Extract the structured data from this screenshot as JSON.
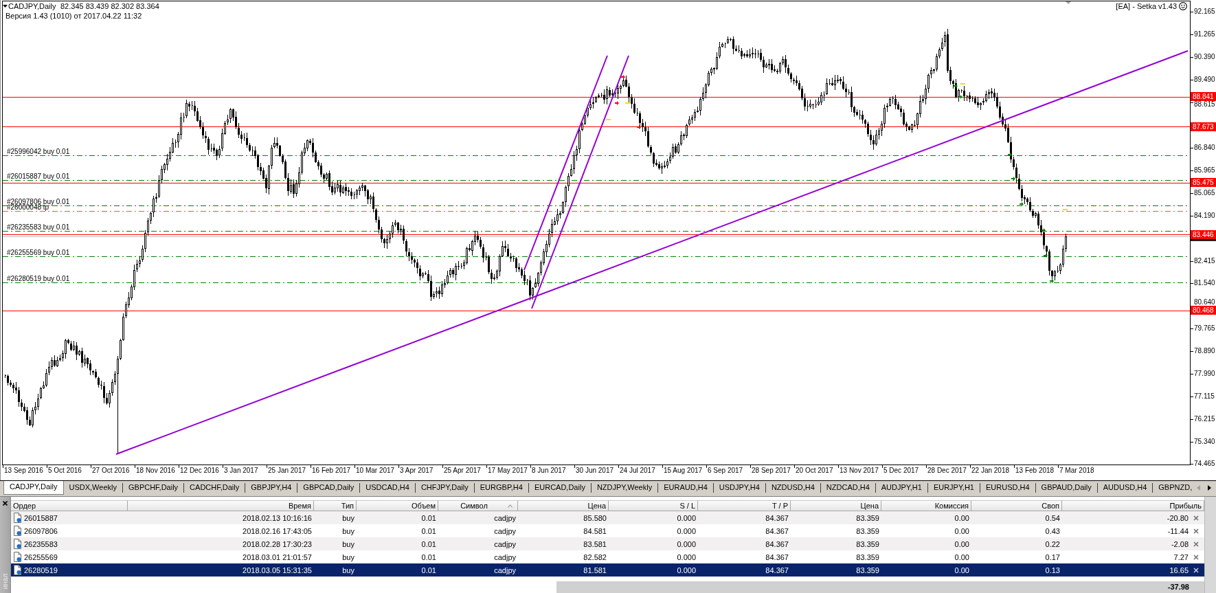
{
  "chart": {
    "symbol": "CADJPY,Daily",
    "ohlc": "82.345 83.439 82.302 83.364",
    "version": "Версия 1.43 (1010) от 2017.04.22 11:32",
    "expert": "[EA] - Setka v1.43",
    "price_ticks": [
      "92.165",
      "91.265",
      "90.390",
      "89.490",
      "88.615",
      "86.840",
      "85.965",
      "85.065",
      "84.190",
      "82.415",
      "81.540",
      "80.640",
      "79.765",
      "78.890",
      "77.990",
      "77.115",
      "76.215",
      "75.340",
      "74.465"
    ],
    "level_tags": [
      "88.841",
      "87.673",
      "85.475",
      "83.446",
      "80.468"
    ],
    "order_lines": [
      {
        "label": "#25996042 buy 0.01",
        "kind": "buy"
      },
      {
        "label": "#26015887 buy 0.01",
        "kind": "buy"
      },
      {
        "label": "#26097806 buy 0.01",
        "kind": "buy"
      },
      {
        "label": "#26000048 tp",
        "kind": "tp"
      },
      {
        "label": "#26235583 buy 0.01",
        "kind": "buy"
      },
      {
        "label": "#26255569 buy 0.01",
        "kind": "buy"
      },
      {
        "label": "#26280519 buy 0.01",
        "kind": "buy"
      }
    ],
    "date_ticks": [
      "13 Sep 2016",
      "5 Oct 2016",
      "27 Oct 2016",
      "18 Nov 2016",
      "12 Dec 2016",
      "3 Jan 2017",
      "25 Jan 2017",
      "16 Feb 2017",
      "10 Mar 2017",
      "3 Apr 2017",
      "25 Apr 2017",
      "17 May 2017",
      "8 Jun 2017",
      "30 Jun 2017",
      "24 Jul 2017",
      "15 Aug 2017",
      "6 Sep 2017",
      "28 Sep 2017",
      "20 Oct 2017",
      "13 Nov 2017",
      "5 Dec 2017",
      "28 Dec 2017",
      "22 Jan 2018",
      "13 Feb 2018",
      "7 Mar 2018"
    ]
  },
  "tabs": [
    {
      "label": "CADJPY,Daily",
      "selected": true
    },
    {
      "label": "USDX,Weekly",
      "selected": false
    },
    {
      "label": "GBPCHF,Daily",
      "selected": false
    },
    {
      "label": "CADCHF,Daily",
      "selected": false
    },
    {
      "label": "GBPJPY,H4",
      "selected": false
    },
    {
      "label": "GBPCAD,Daily",
      "selected": false
    },
    {
      "label": "USDCAD,H4",
      "selected": false
    },
    {
      "label": "CHFJPY,Daily",
      "selected": false
    },
    {
      "label": "EURGBP,H4",
      "selected": false
    },
    {
      "label": "EURCAD,Daily",
      "selected": false
    },
    {
      "label": "NZDJPY,Weekly",
      "selected": false
    },
    {
      "label": "EURAUD,H4",
      "selected": false
    },
    {
      "label": "USDJPY,H4",
      "selected": false
    },
    {
      "label": "NZDUSD,H4",
      "selected": false
    },
    {
      "label": "NZDCAD,H4",
      "selected": false
    },
    {
      "label": "AUDJPY,H1",
      "selected": false
    },
    {
      "label": "EURJPY,H1",
      "selected": false
    },
    {
      "label": "EURUSD,H4",
      "selected": false
    },
    {
      "label": "GBPAUD,Daily",
      "selected": false
    },
    {
      "label": "AUDUSD,H4",
      "selected": false
    },
    {
      "label": "GBPNZD,",
      "selected": false
    }
  ],
  "tab_scroll_buttons": [
    {
      "kind": "left",
      "disabled": true
    },
    {
      "kind": "right",
      "disabled": false
    }
  ],
  "terminal": {
    "side_label": "инал",
    "columns": [
      {
        "label": "Ордер",
        "sorted": false
      },
      {
        "label": "Время",
        "sorted": false
      },
      {
        "label": "Тип",
        "sorted": false
      },
      {
        "label": "Объем",
        "sorted": false
      },
      {
        "label": "Символ",
        "sorted": true
      },
      {
        "label": "Цена",
        "sorted": false
      },
      {
        "label": "S / L",
        "sorted": false
      },
      {
        "label": "T / P",
        "sorted": false
      },
      {
        "label": "Цена",
        "sorted": false
      },
      {
        "label": "Комиссия",
        "sorted": false
      },
      {
        "label": "Своп",
        "sorted": false
      },
      {
        "label": "Прибыль",
        "sorted": false
      }
    ],
    "rows": [
      {
        "cells": [
          "26015887",
          "2018.02.13 10:16:16",
          "buy",
          "0.01",
          "cadjpy",
          "85.580",
          "0.000",
          "84.367",
          "83.359",
          "0.00",
          "0.54",
          "-20.80"
        ],
        "selected": false
      },
      {
        "cells": [
          "26097806",
          "2018.02.16 17:43:05",
          "buy",
          "0.01",
          "cadjpy",
          "84.581",
          "0.000",
          "84.367",
          "83.359",
          "0.00",
          "0.43",
          "-11.44"
        ],
        "selected": false
      },
      {
        "cells": [
          "26235583",
          "2018.02.28 17:30:23",
          "buy",
          "0.01",
          "cadjpy",
          "83.581",
          "0.000",
          "84.367",
          "83.359",
          "0.00",
          "0.22",
          "-2.08"
        ],
        "selected": false
      },
      {
        "cells": [
          "26255569",
          "2018.03.01 21:01:57",
          "buy",
          "0.01",
          "cadjpy",
          "82.582",
          "0.000",
          "84.367",
          "83.359",
          "0.00",
          "0.17",
          "7.27"
        ],
        "selected": false
      },
      {
        "cells": [
          "26280519",
          "2018.03.05 15:31:35",
          "buy",
          "0.01",
          "cadjpy",
          "81.581",
          "0.000",
          "84.367",
          "83.359",
          "0.00",
          "0.13",
          "16.65"
        ],
        "selected": true
      }
    ],
    "total": "-37.98"
  }
}
